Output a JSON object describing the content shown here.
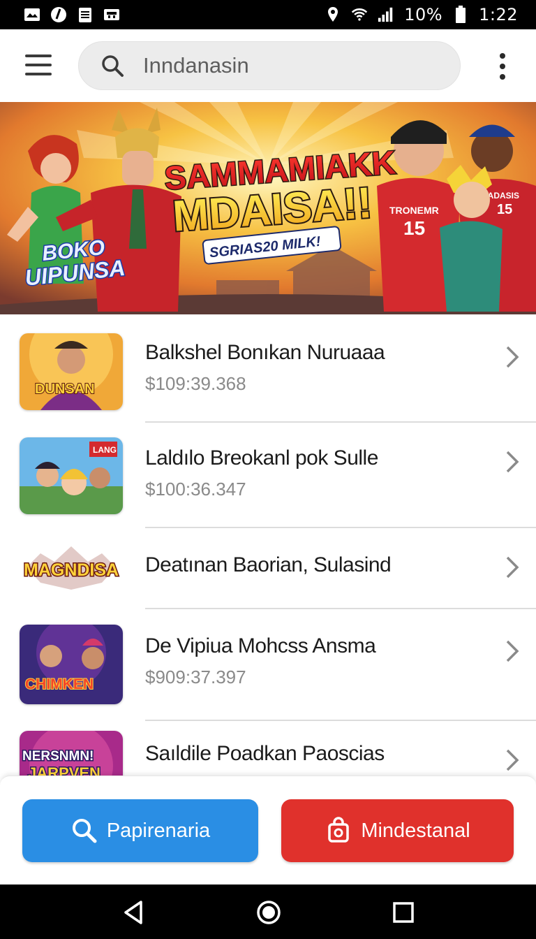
{
  "status_bar": {
    "battery_percent": "10%",
    "time": "1:22"
  },
  "search": {
    "value": "Inndanasin"
  },
  "banner": {
    "headline_line1": "SAMMAMIAKK",
    "headline_line2": "MDAISA!!",
    "subtitle": "SGRIAS20 MILK!",
    "logo_line1": "BOKO",
    "logo_line2": "UIPUNSA",
    "jersey_text": "TRONEMR",
    "jersey_number": "15",
    "jersey2_text": "CADASIS",
    "jersey2_number": "15"
  },
  "list": {
    "items": [
      {
        "title": "Balkshel Bonıkan Nuruaaa",
        "price": "$109:39.368",
        "thumb_text": "DUNSAN"
      },
      {
        "title": "Laldılo Breokanl pok Sulle",
        "price": "$100:36.347",
        "thumb_text": "LANG"
      },
      {
        "title": "Deatınan Baorian, Sulasind",
        "price": "",
        "thumb_text": "MAGNDISA"
      },
      {
        "title": "De Vipiua Mohcss Ansma",
        "price": "$909:37.397",
        "thumb_text": "CHIMKEN"
      },
      {
        "title": "Saıldile Poadkan Paoscias",
        "price": "",
        "thumb_text": "NERSNMN! JARPVEN"
      }
    ]
  },
  "actions": {
    "search_label": "Papirenaria",
    "store_label": "Mindestanal",
    "colors": {
      "blue": "#2a8ee4",
      "red": "#e0312c"
    }
  },
  "icons": {
    "status_left": [
      "gallery-icon",
      "data-saver-icon",
      "clipboard-icon",
      "image-icon"
    ],
    "status_right": [
      "location-icon",
      "wifi-icon",
      "signal-icon",
      "battery-icon"
    ],
    "nav": [
      "back-icon",
      "home-icon",
      "recents-icon"
    ]
  }
}
